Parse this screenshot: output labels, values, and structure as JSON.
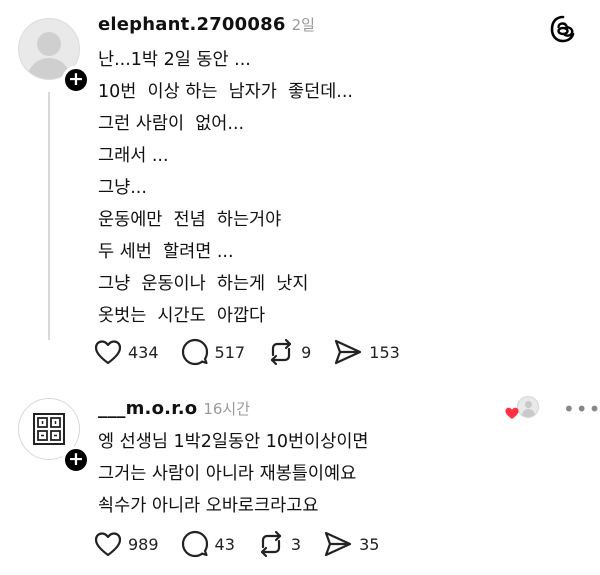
{
  "posts": [
    {
      "username": "elephant.2700086",
      "time": "2일",
      "lines": [
        "난...1박 2일 동안 ...",
        "10번  이상 하는  남자가  좋던데...",
        "그런 사람이  없어...",
        "그래서 ...",
        "그냥...",
        "운동에만  전념  하는거야",
        "두 세번  할려면 ...",
        "그냥  운동이나  하는게  낫지",
        "옷벗는  시간도  아깝다"
      ],
      "likes": "434",
      "comments": "517",
      "reposts": "9",
      "shares": "153"
    },
    {
      "username": "___m.o.r.o",
      "time": "16시간",
      "lines": [
        "엥 선생님 1박2일동안 10번이상이면",
        "그거는 사람이 아니라 재봉틀이예요",
        "쇡수가 아니라 오바로크라고요"
      ],
      "likes": "989",
      "comments": "43",
      "reposts": "3",
      "shares": "35"
    }
  ],
  "colors": {
    "heart_badge": "#ff3040",
    "muted": "#9a9a9a"
  }
}
